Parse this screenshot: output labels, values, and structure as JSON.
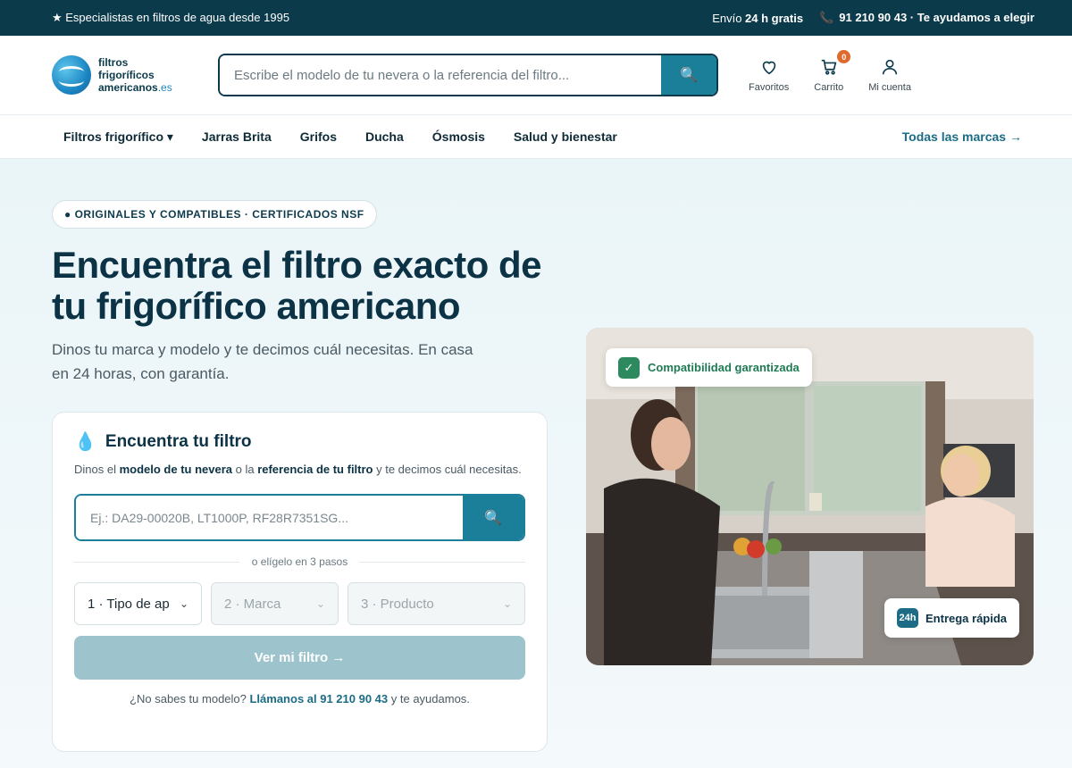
{
  "topbar": {
    "tagline": "★ Especialistas en filtros de agua desde 1995",
    "shipping_prefix": "Envío ",
    "shipping_bold": "24 h gratis",
    "phone": "91 210 90 43",
    "help_text": "· Te ayudamos a elegir"
  },
  "logo": {
    "line1": "filtros",
    "line2": "frigoríficos",
    "line3": "americanos",
    "tld": ".es"
  },
  "header": {
    "search_placeholder": "Escribe el modelo de tu nevera o la referencia del filtro...",
    "favorites_label": "Favoritos",
    "cart_label": "Carrito",
    "cart_count": "0",
    "account_label": "Mi cuenta"
  },
  "nav": {
    "items": [
      {
        "label": "Filtros frigorífico ▾"
      },
      {
        "label": "Jarras Brita"
      },
      {
        "label": "Grifos"
      },
      {
        "label": "Ducha"
      },
      {
        "label": "Ósmosis"
      },
      {
        "label": "Salud y bienestar"
      }
    ],
    "all_brands": "Todas las marcas →"
  },
  "hero": {
    "pill": "● ORIGINALES Y COMPATIBLES · CERTIFICADOS NSF",
    "title": "Encuentra el filtro exacto de tu frigorífico americano",
    "lead": "Dinos tu marca y modelo y te decimos cuál necesitas. En casa en 24 horas, con garantía."
  },
  "finder": {
    "title": "Encuentra tu filtro",
    "desc_1": "Dinos el ",
    "desc_b1": "modelo de tu nevera",
    "desc_2": " o la ",
    "desc_b2": "referencia de tu filtro",
    "desc_3": " y te decimos cuál necesitas.",
    "search_placeholder": "Ej.: DA29-00020B, LT1000P, RF28R7351SG...",
    "divider": "o elígelo en 3 pasos",
    "step1": "1 · Tipo de ap",
    "step2": "2 · Marca",
    "step3": "3 · Producto",
    "cta": "Ver mi filtro →",
    "help_1": "¿No sabes tu modelo? ",
    "help_b": "Llámanos al 91 210 90 43",
    "help_2": " y te ayudamos."
  },
  "badges": {
    "compat": "Compatibilidad garantizada",
    "h24": "24h",
    "fast": "Entrega rápida"
  },
  "colors": {
    "primary": "#0b3a4b",
    "accent": "#1b7f9a",
    "cart_badge": "#e0692e"
  }
}
